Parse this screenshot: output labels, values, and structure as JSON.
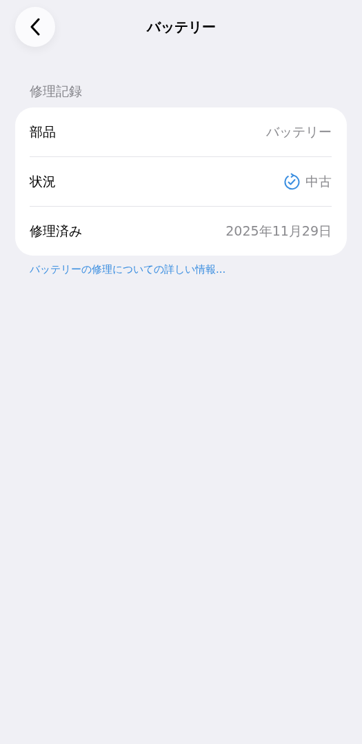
{
  "nav": {
    "title": "バッテリー"
  },
  "section": {
    "header": "修理記録",
    "rows": [
      {
        "kind": "text",
        "label": "部品",
        "value": "バッテリー"
      },
      {
        "kind": "status",
        "label": "状況",
        "value": "中古"
      },
      {
        "kind": "text",
        "label": "修理済み",
        "value": "2025年11月29日"
      }
    ],
    "footer_link": "バッテリーの修理についての詳しい情報..."
  }
}
